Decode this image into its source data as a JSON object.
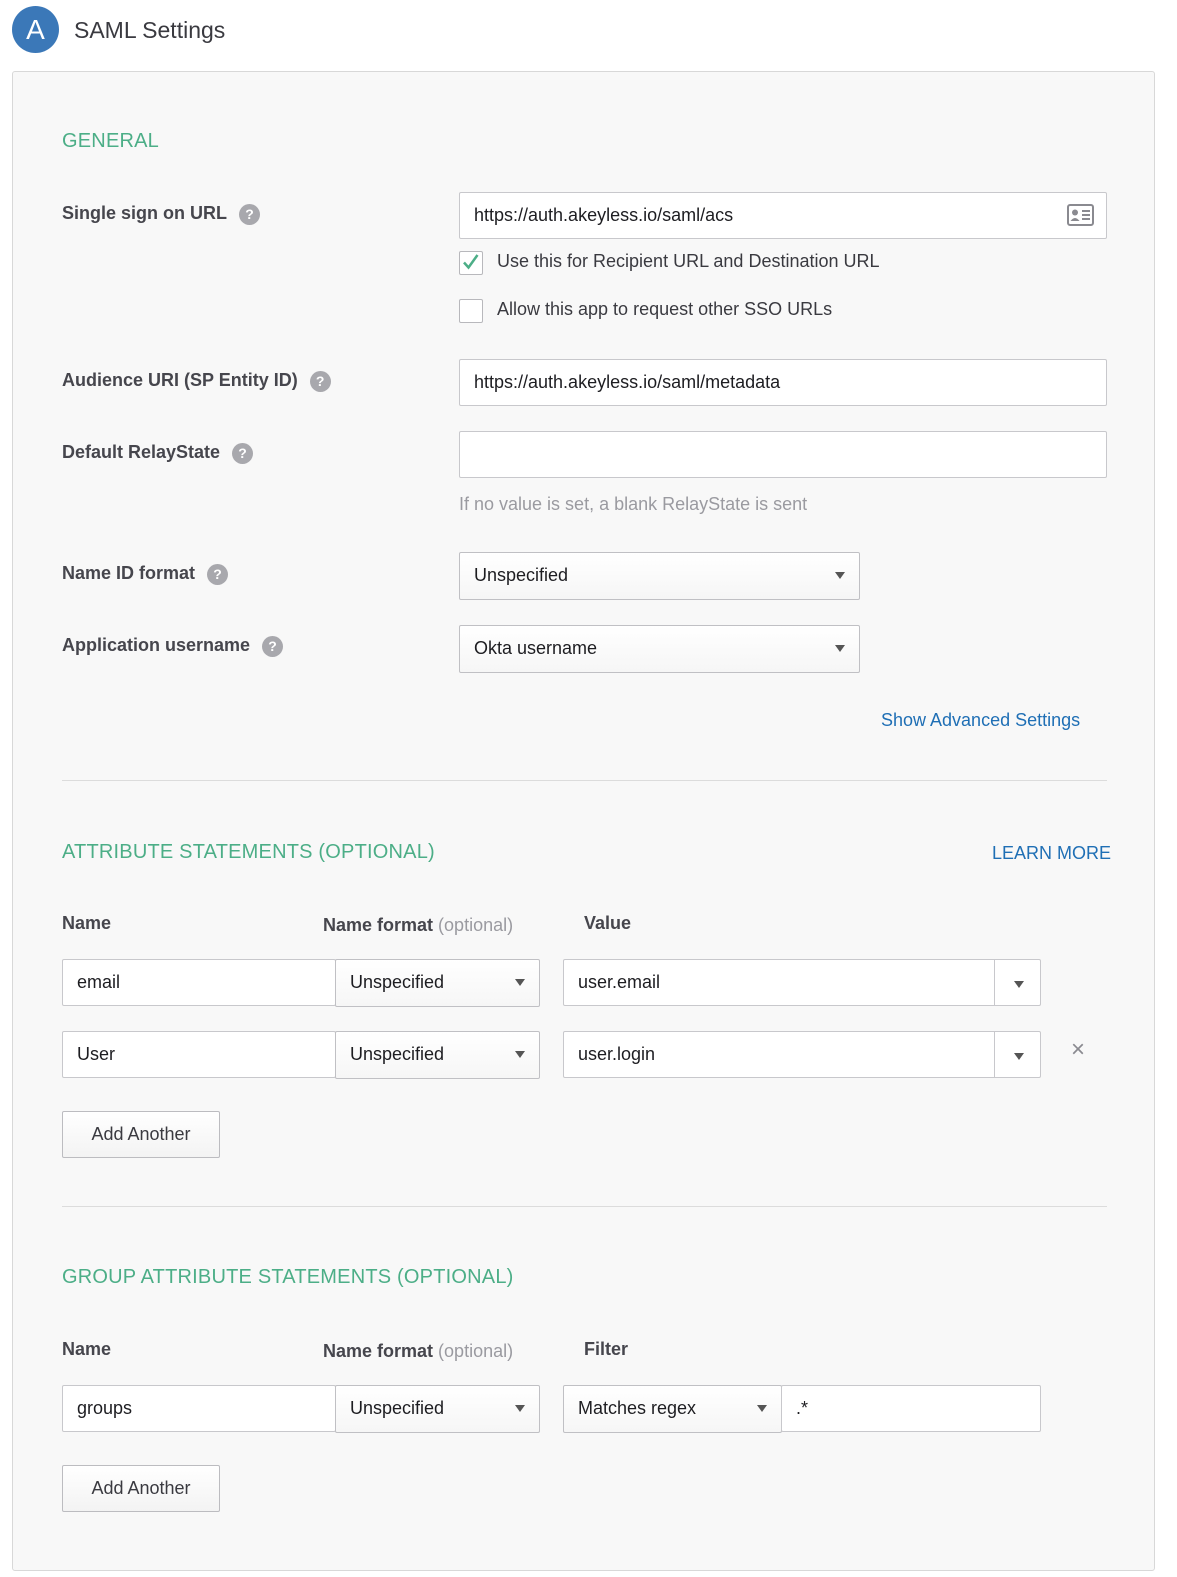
{
  "step": {
    "badge": "A",
    "title": "SAML Settings"
  },
  "general": {
    "heading": "GENERAL",
    "sso_url": {
      "label": "Single sign on URL",
      "value": "https://auth.akeyless.io/saml/acs"
    },
    "recipient_checkbox": {
      "label": "Use this for Recipient URL and Destination URL",
      "checked": true
    },
    "other_sso_checkbox": {
      "label": "Allow this app to request other SSO URLs",
      "checked": false
    },
    "audience_uri": {
      "label": "Audience URI (SP Entity ID)",
      "value": "https://auth.akeyless.io/saml/metadata"
    },
    "relay_state": {
      "label": "Default RelayState",
      "value": "",
      "hint": "If no value is set, a blank RelayState is sent"
    },
    "name_id_format": {
      "label": "Name ID format",
      "value": "Unspecified"
    },
    "app_username": {
      "label": "Application username",
      "value": "Okta username"
    },
    "advanced_link": "Show Advanced Settings",
    "help_glyph": "?"
  },
  "attributes": {
    "heading": "ATTRIBUTE STATEMENTS (OPTIONAL)",
    "learn_more": "LEARN MORE",
    "columns": {
      "name": "Name",
      "format": "Name format",
      "format_opt": "(optional)",
      "value": "Value"
    },
    "rows": [
      {
        "name": "email",
        "format": "Unspecified",
        "value": "user.email"
      },
      {
        "name": "User",
        "format": "Unspecified",
        "value": "user.login"
      }
    ],
    "remove_glyph": "×",
    "add_button": "Add Another"
  },
  "group_attributes": {
    "heading": "GROUP ATTRIBUTE STATEMENTS (OPTIONAL)",
    "columns": {
      "name": "Name",
      "format": "Name format",
      "format_opt": "(optional)",
      "filter": "Filter"
    },
    "rows": [
      {
        "name": "groups",
        "format": "Unspecified",
        "filter_type": "Matches regex",
        "filter_value": ".*"
      }
    ],
    "add_button": "Add Another"
  },
  "colors": {
    "accent_green": "#4cae87",
    "link_blue": "#1f6fb5",
    "badge_blue": "#3b78b8"
  }
}
